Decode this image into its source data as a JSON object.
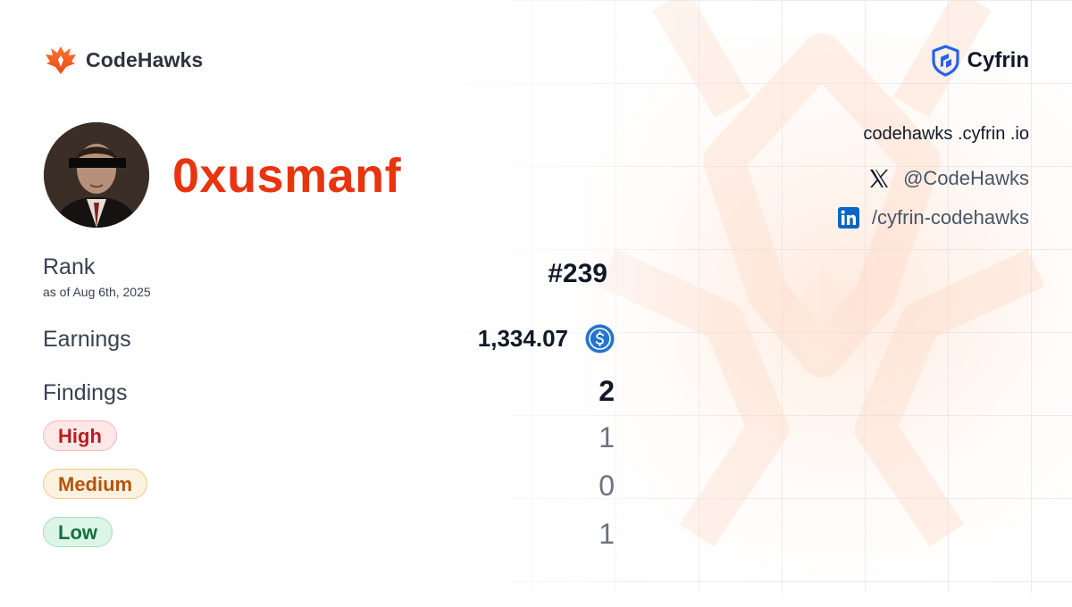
{
  "brand": {
    "name": "CodeHawks",
    "logo_icon": "hawk-logo-icon",
    "accent": "#f26a2e"
  },
  "partner": {
    "name": "Cyfrin",
    "logo_icon": "cyfrin-shield-icon",
    "color": "#2563eb"
  },
  "links": {
    "website": "codehawks  .cyfrin .io",
    "twitter": "@CodeHawks",
    "linkedin": "/cyfrin-codehawks"
  },
  "profile": {
    "username": "0xusmanf",
    "username_color": "#e8340f"
  },
  "stats": {
    "rank_label": "Rank",
    "rank_date": "as of Aug 6th, 2025",
    "rank_value": "#239",
    "earnings_label": "Earnings",
    "earnings_value": "1,334.07",
    "earnings_icon": "usdc-coin-icon",
    "findings_label": "Findings",
    "findings_value": "2"
  },
  "severities": [
    {
      "label": "High",
      "count": "1",
      "color": "#b51f1f"
    },
    {
      "label": "Medium",
      "count": "0",
      "color": "#b4550c"
    },
    {
      "label": "Low",
      "count": "1",
      "color": "#15703f"
    }
  ]
}
